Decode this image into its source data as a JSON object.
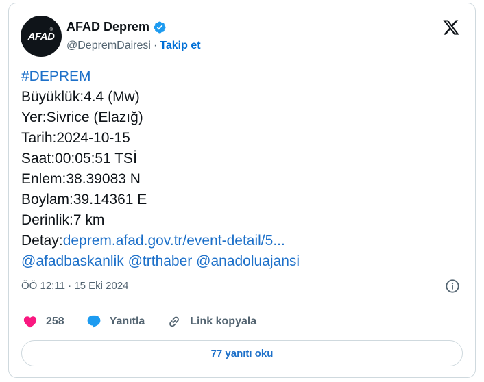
{
  "author": {
    "avatar_text": "AFAD",
    "name": "AFAD Deprem",
    "handle": "@DepremDairesi",
    "separator": "·",
    "follow_label": "Takip et"
  },
  "tweet": {
    "hashtag": "#DEPREM",
    "lines": [
      "Büyüklük:4.4 (Mw)",
      "Yer:Sivrice (Elazığ)",
      "Tarih:2024-10-15",
      "Saat:00:05:51 TSİ",
      "Enlem:38.39083 N",
      "Boylam:39.14361 E",
      "Derinlik:7 km"
    ],
    "detail_label": "Detay:",
    "detail_link": "deprem.afad.gov.tr/event-detail/5...",
    "mentions": [
      "@afadbaskanlik",
      "@trthaber",
      "@anadoluajansi"
    ]
  },
  "meta": {
    "time": "ÖÖ 12:11",
    "separator": "·",
    "date": "15 Eki 2024"
  },
  "actions": {
    "like_count": "258",
    "reply_label": "Yanıtla",
    "copy_link_label": "Link kopyala"
  },
  "replies_button": "77 yanıtı oku",
  "colors": {
    "link": "#1d70c9",
    "like": "#f91880",
    "verified": "#1d9bf0"
  }
}
